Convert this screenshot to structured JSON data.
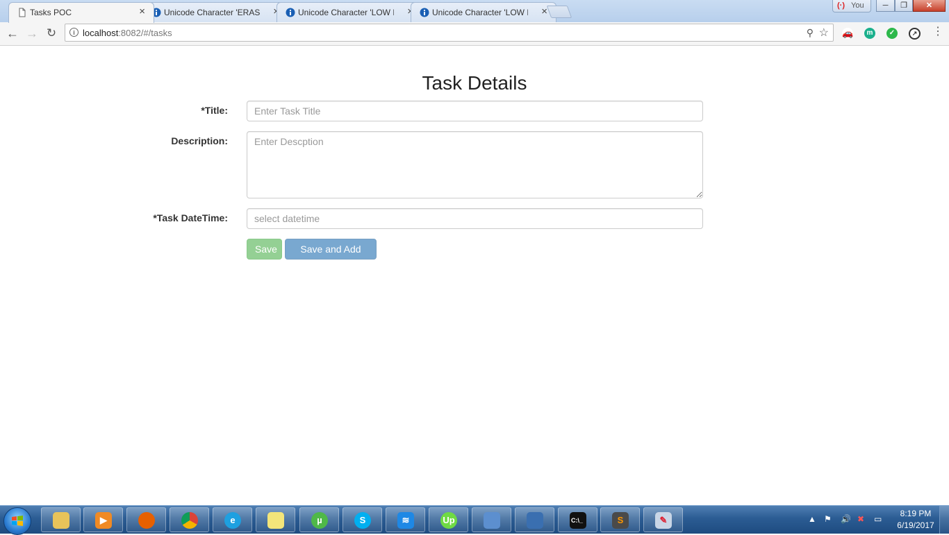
{
  "browser": {
    "tabs": [
      {
        "title": "Tasks POC",
        "icon": "document-icon",
        "active": true
      },
      {
        "title": "Unicode Character 'ERASE TO THE LEFT'",
        "icon": "info-icon"
      },
      {
        "title": "Unicode Character 'LOW LINE'",
        "icon": "info-icon"
      },
      {
        "title": "Unicode Character 'LOW LINE'",
        "icon": "info-icon"
      }
    ],
    "profile_label": "You",
    "url_host": "localhost",
    "url_rest": ":8082/#/tasks",
    "window_controls": [
      "─",
      "❐",
      "✕"
    ]
  },
  "form": {
    "heading": "Task Details",
    "title_label": "*Title:",
    "title_placeholder": "Enter Task Title",
    "description_label": "Description:",
    "description_placeholder": "Enter Descption",
    "datetime_label": "*Task DateTime:",
    "datetime_placeholder": "select datetime",
    "save_label": "Save",
    "save_and_new_label": "Save and Add New"
  },
  "taskbar": {
    "time": "8:19 PM",
    "date": "6/19/2017",
    "apps": [
      "file-explorer",
      "media-player",
      "firefox",
      "chrome",
      "internet-explorer",
      "sticky-notes",
      "utorrent",
      "skype",
      "wifi-manager",
      "upwork",
      "control-panel",
      "remote-desktop",
      "command-prompt",
      "sublime-text",
      "paint"
    ]
  },
  "colors": {
    "save_button": "#5cb85c",
    "save_and_new_button": "#337ab7"
  }
}
